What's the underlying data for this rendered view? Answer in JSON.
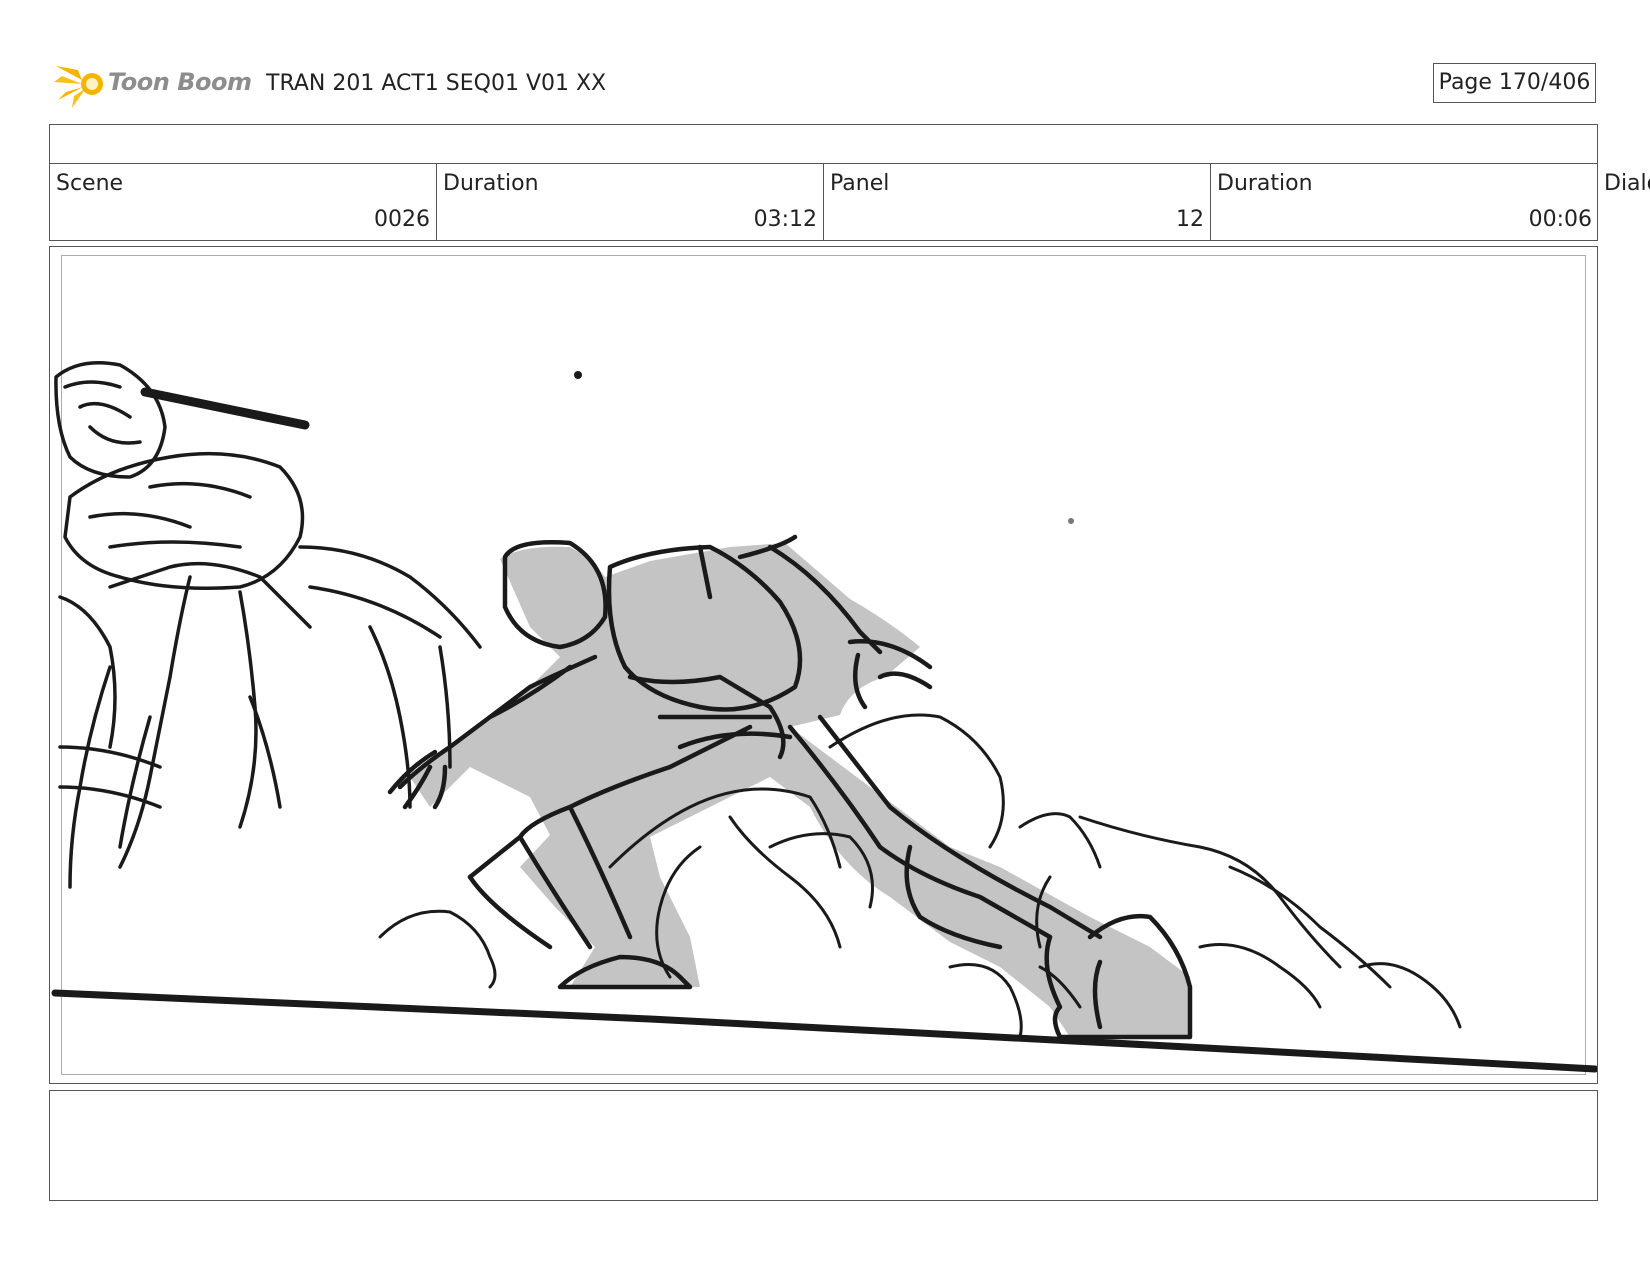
{
  "header": {
    "brand": "Toon Boom",
    "title": "TRAN 201 ACT1 SEQ01 V01 XX",
    "page_label": "Page 170/406"
  },
  "info": {
    "scene_label": "Scene",
    "scene_value": "0026",
    "scene_duration_label": "Duration",
    "scene_duration_value": "03:12",
    "panel_label": "Panel",
    "panel_value": "12",
    "panel_duration_label": "Duration",
    "panel_duration_value": "00:06",
    "dialog_label": "Dialo"
  },
  "colors": {
    "ink": "#1a1a1a",
    "shade": "#c4c4c4",
    "logo_star": "#f5b400",
    "logo_text": "#8d8d8d"
  },
  "icons": {
    "logo": "toon-boom-star-icon"
  }
}
